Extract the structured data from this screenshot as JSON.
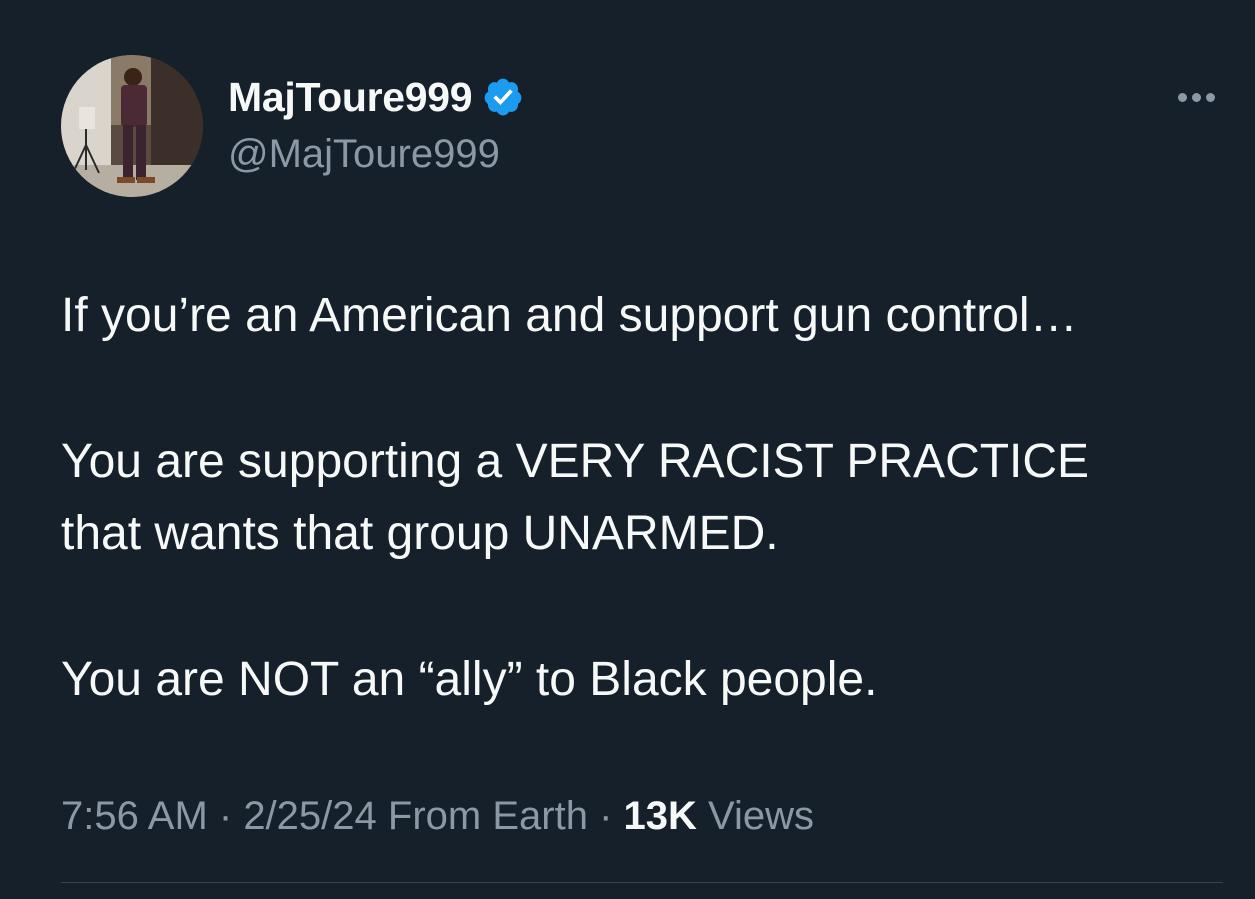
{
  "author": {
    "display_name": "MajToure999",
    "handle": "@MajToure999",
    "verified": true,
    "verified_color": "#1d9bf0"
  },
  "tweet": {
    "paragraphs": [
      "If you’re an American and support gun control…",
      "You are supporting a VERY RACIST PRACTICE",
      "that wants that group UNARMED.",
      "You are NOT an “ally” to Black people."
    ]
  },
  "meta": {
    "time": "7:56 AM",
    "sep1": " · ",
    "date": "2/25/24",
    "location": "From Earth",
    "sep2": " · ",
    "views_count": "13K",
    "views_label": "Views"
  },
  "icons": {
    "more": "more-horizontal-icon",
    "verified": "verified-badge-icon"
  },
  "colors": {
    "background": "#15202b",
    "text_primary": "#f7f9f9",
    "text_secondary": "#8b98a5",
    "divider": "#38444d"
  }
}
